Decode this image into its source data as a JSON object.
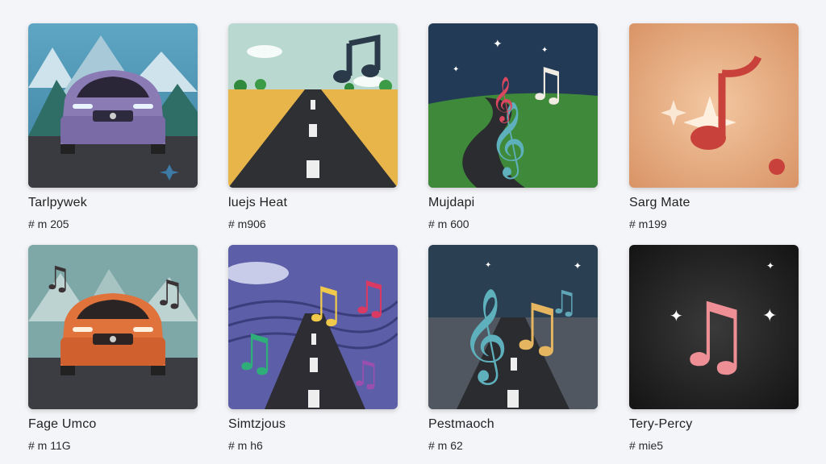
{
  "colors": {
    "page_background": "#f4f5f8",
    "title_text": "#222222"
  },
  "playlists": [
    {
      "title": "Tarlpywek",
      "meta": "# m 205",
      "art": "purple-car-mountains"
    },
    {
      "title": "luejs Heat",
      "meta": "# m906",
      "art": "road-field-note"
    },
    {
      "title": "Mujdapi",
      "meta": "# m 600",
      "art": "night-road-clef"
    },
    {
      "title": "Sarg Mate",
      "meta": "# m199",
      "art": "orange-sparkle-note"
    },
    {
      "title": "Fage Umco",
      "meta": "# m 11G",
      "art": "orange-car-notes"
    },
    {
      "title": "Simtzjous",
      "meta": "# m h6",
      "art": "wavy-road-notes"
    },
    {
      "title": "Pestmaoch",
      "meta": "# m 62",
      "art": "dusk-road-clef"
    },
    {
      "title": "Tery-Percy",
      "meta": "# mie5",
      "art": "dark-sparkle-note"
    }
  ]
}
